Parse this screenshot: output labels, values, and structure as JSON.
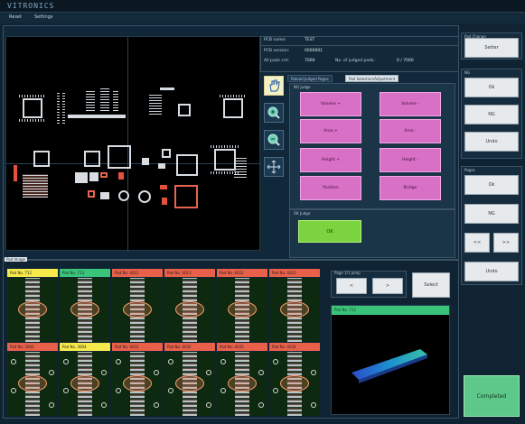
{
  "app": {
    "logo_text": "VITRONICS"
  },
  "menu": {
    "items": [
      "Reset",
      "Settings"
    ]
  },
  "info": {
    "pcb_name_label": "PCB name:",
    "pcb_name_value": "TEST",
    "pcb_version_label": "PCB version:",
    "pcb_version_value": "0000001",
    "all_pads_label": "All pads cnt:",
    "all_pads_value": "7000",
    "judged_label": "No. of judged pads:",
    "judged_value": "0 / 7000"
  },
  "tabs": {
    "tab1": "Reload Judged Pages",
    "tab2": "Pad Selection/Adjustment"
  },
  "judge_group": {
    "label": "NG Judge",
    "buttons": [
      "Volume +",
      "Volume -",
      "Area +",
      "Area -",
      "Height +",
      "Height -",
      "Position",
      "Bridge"
    ]
  },
  "ok_group": {
    "label": "OK Judge",
    "ok_button": "OK"
  },
  "right_panel": {
    "pad_change_label": "Pad Change",
    "pad_change_button": "Setter",
    "nav_label": "NG",
    "nav_buttons": [
      "Ok",
      "NG",
      "Undo"
    ],
    "pages_label": "Pages",
    "pages_buttons": [
      "Ok",
      "NG",
      "<<",
      ">>",
      "Undo"
    ],
    "completed_button": "Completed"
  },
  "thumbnails": {
    "section_label": "Pad Image",
    "labels": [
      "Pad No. 712",
      "Pad No. 713",
      "Pad No. 4012",
      "Pad No. 4013",
      "Pad No. 4022",
      "Pad No. 4023",
      "Pad No. 3003",
      "Pad No. 3004",
      "Pad No. 4031",
      "Pad No. 4032",
      "Pad No. 4033",
      "Pad No. 4034"
    ],
    "label_colors": [
      "#f6e94a",
      "#39c47a",
      "#e8604a",
      "#e8604a",
      "#e8604a",
      "#e8604a",
      "#e8604a",
      "#f6e94a",
      "#e8604a",
      "#e8604a",
      "#e8604a",
      "#e8604a"
    ]
  },
  "page_ctrl": {
    "label": "Page 1/1 Jump",
    "prev": "<",
    "next": ">",
    "select_button": "Select"
  },
  "view3d": {
    "title": "Pad No. 712"
  }
}
